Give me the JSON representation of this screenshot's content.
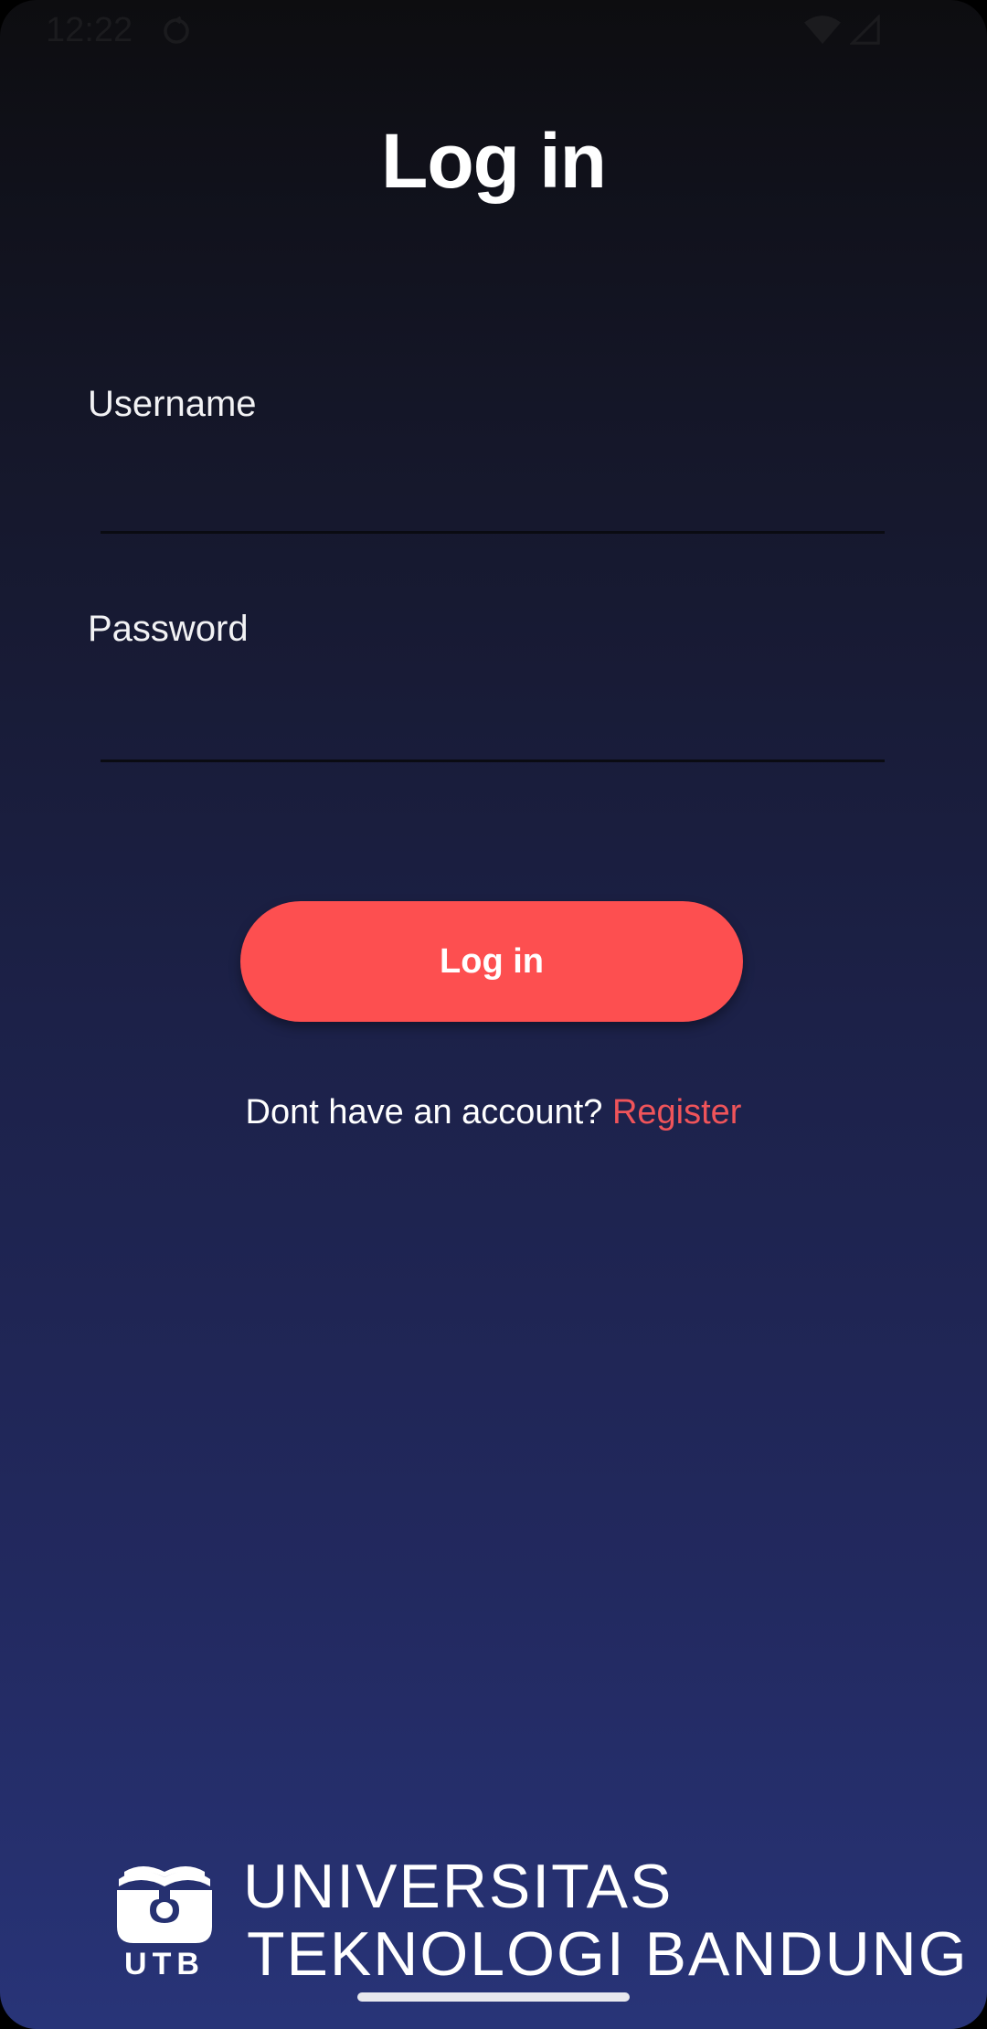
{
  "status_bar": {
    "time": "12:22",
    "icons": [
      "sync-icon",
      "wifi-icon",
      "signal-icon"
    ]
  },
  "title": "Log in",
  "form": {
    "username_label": "Username",
    "username_value": "",
    "password_label": "Password",
    "password_value": "",
    "login_button": "Log in"
  },
  "register": {
    "prompt": "Dont have an account?",
    "link": "Register"
  },
  "logo": {
    "emblem_text": "UTB",
    "line1": "UNIVERSITAS",
    "line2": "TEKNOLOGI BANDUNG"
  },
  "colors": {
    "accent": "#fd4f50",
    "link": "#f0545a",
    "background_top": "#0d0d10",
    "background_bottom": "#283478"
  }
}
